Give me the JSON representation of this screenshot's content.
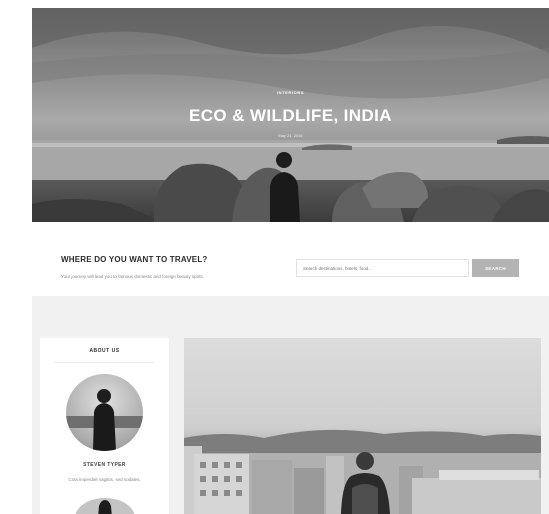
{
  "hero": {
    "category": "INTERIORS",
    "title": "ECO & WILDLIFE, INDIA",
    "date": "May 21, 2016"
  },
  "search_band": {
    "title": "WHERE DO YOU WANT TO TRAVEL?",
    "subtitle": "Your journey will lead you to famous domestic and foreign beauty spots.",
    "placeholder": "Search destinations, hotels, food...",
    "button_label": "SEARCH"
  },
  "sidebar": {
    "title": "ABOUT US",
    "name": "STEVEN TYPER",
    "bio": "Cras imperdiet sagittis, sed sodales."
  },
  "icons": {
    "hero_image": "photo-icon",
    "avatar": "person-icon"
  }
}
